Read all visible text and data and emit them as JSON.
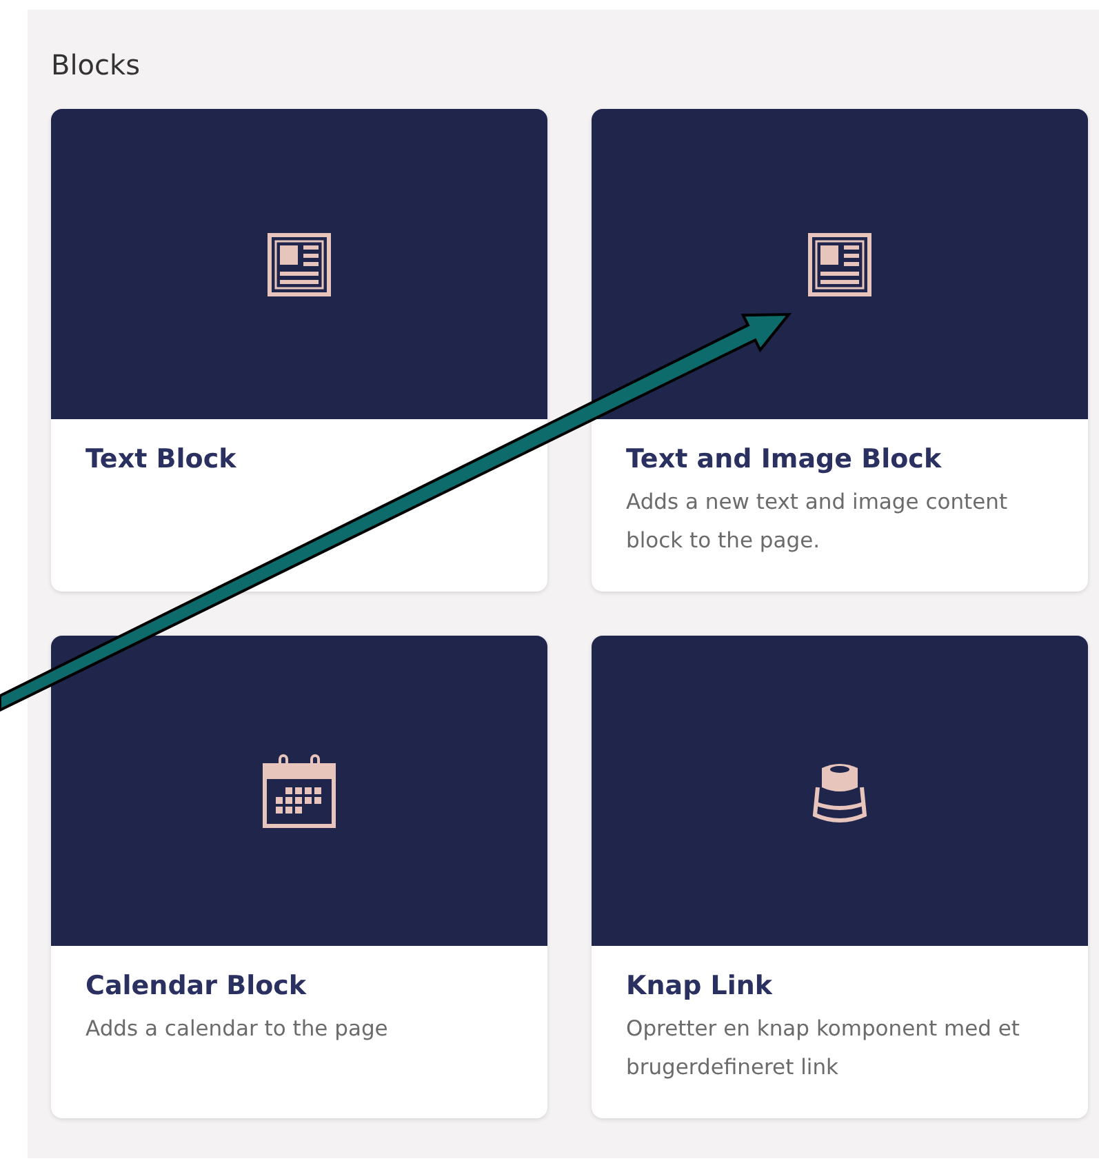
{
  "panel": {
    "title": "Blocks"
  },
  "blocks": [
    {
      "kind": "article",
      "title": "Text Block"
    },
    {
      "kind": "article",
      "title": "Text and Image Block",
      "description": "Adds a new text and image content block to the page."
    },
    {
      "kind": "calendar",
      "title": "Calendar Block",
      "description": "Adds a calendar to the page"
    },
    {
      "kind": "button",
      "title": "Knap Link",
      "description": "Opretter en knap komponent med et brugerdefineret link"
    }
  ]
}
